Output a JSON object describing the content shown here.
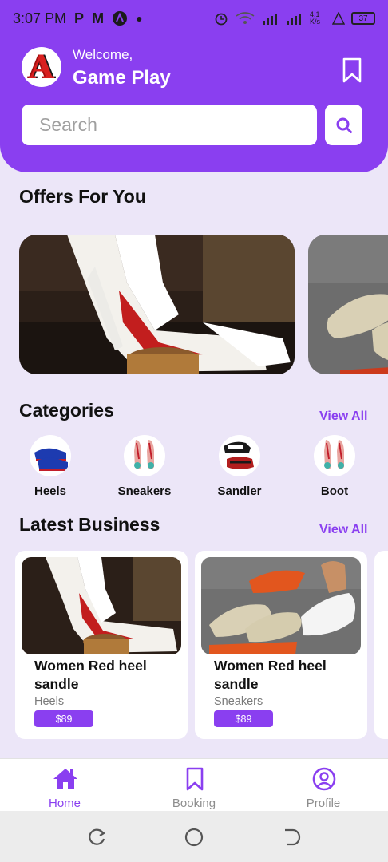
{
  "status_bar": {
    "time": "3:07 PM",
    "left_icons": [
      "P",
      "M"
    ],
    "net_speed": "4.1 K/s",
    "battery": "37"
  },
  "header": {
    "avatar_letter": "A",
    "welcome": "Welcome,",
    "username": "Game Play",
    "bookmark_icon": "bookmark-icon"
  },
  "search": {
    "placeholder": "Search",
    "icon": "search-icon"
  },
  "offers": {
    "title": "Offers For You"
  },
  "categories": {
    "title": "Categories",
    "view_all": "View All",
    "items": [
      {
        "label": "Heels"
      },
      {
        "label": "Sneakers"
      },
      {
        "label": "Sandler"
      },
      {
        "label": "Boot"
      }
    ]
  },
  "latest_business": {
    "title": "Latest Business",
    "view_all": "View All",
    "items": [
      {
        "title": "Women Red heel sandle",
        "category": "Heels",
        "price": "$89"
      },
      {
        "title": "Women Red heel sandle",
        "category": "Sneakers",
        "price": "$89"
      }
    ]
  },
  "bottom_nav": {
    "items": [
      {
        "label": "Home",
        "icon": "home-icon",
        "active": true
      },
      {
        "label": "Booking",
        "icon": "bookmark-icon",
        "active": false
      },
      {
        "label": "Profile",
        "icon": "profile-icon",
        "active": false
      }
    ]
  },
  "colors": {
    "accent": "#8a3ff0",
    "background": "#ece6f8"
  }
}
